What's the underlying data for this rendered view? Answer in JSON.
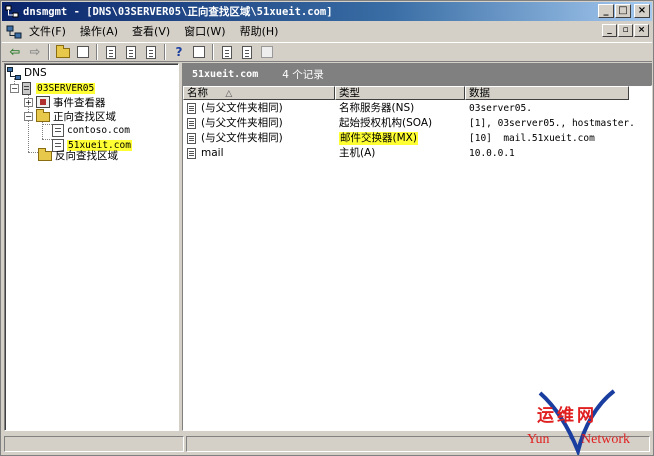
{
  "window": {
    "title": "dnsmgmt - [DNS\\03SERVER05\\正向查找区域\\51xueit.com]",
    "buttons": {
      "minimize": "_",
      "maximize": "□",
      "close": "×"
    }
  },
  "menu": {
    "items": [
      "文件(F)",
      "操作(A)",
      "查看(V)",
      "窗口(W)",
      "帮助(H)"
    ],
    "mdi_buttons": {
      "minimize": "_",
      "restore": "▫",
      "close": "×"
    }
  },
  "toolbar": {
    "buttons": [
      "back-icon",
      "forward-icon",
      "up-folder-icon",
      "show-tree-icon",
      "properties-icon",
      "refresh-icon",
      "export-icon",
      "help-icon",
      "console-tree-icon",
      "server-icon",
      "record-icon",
      "zone-icon"
    ]
  },
  "tree": {
    "root": "DNS",
    "server": "03SERVER05",
    "event_viewer": "事件查看器",
    "forward_zones": "正向查找区域",
    "zone_contoso": "contoso.com",
    "zone_51xueit": "51xueit.com",
    "reverse_zones": "反向查找区域"
  },
  "details": {
    "zone_name": "51xueit.com",
    "record_count": "4 个记录",
    "columns": {
      "name": "名称",
      "sort_indicator": "△",
      "type": "类型",
      "data": "数据"
    },
    "rows": [
      {
        "name": "(与父文件夹相同)",
        "type": "名称服务器(NS)",
        "data": "03server05."
      },
      {
        "name": "(与父文件夹相同)",
        "type": "起始授权机构(SOA)",
        "data": "[1], 03server05., hostmaster."
      },
      {
        "name": "(与父文件夹相同)",
        "type": "邮件交换器(MX)",
        "data": "[10]  mail.51xueit.com"
      },
      {
        "name": "mail",
        "type": "主机(A)",
        "data": "10.0.0.1"
      }
    ]
  },
  "watermark": {
    "chinese": "运维网",
    "latin_left": "Yun",
    "latin_right": "Network"
  },
  "colors": {
    "highlight": "#ffff33",
    "titlebar": "#0a246a",
    "watermark": "#e02020"
  }
}
